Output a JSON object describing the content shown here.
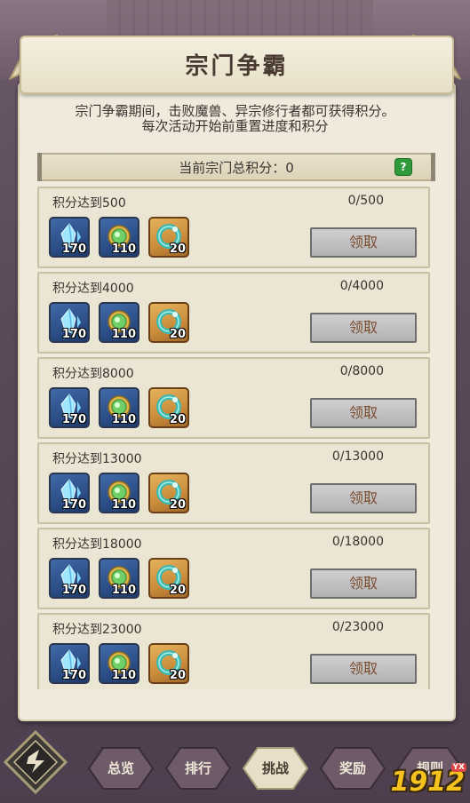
{
  "header": {
    "title": "宗门争霸"
  },
  "description": {
    "line1": "宗门争霸期间，击败魔兽、异宗修行者都可获得积分。",
    "line2": "每次活动开始前重置进度和积分"
  },
  "total": {
    "label": "当前宗门总积分：0",
    "help_icon": "help-icon"
  },
  "tasks": [
    {
      "title": "积分达到500",
      "progress": "0/500",
      "claim": "领取",
      "rewards": [
        {
          "icon": "crystal-icon",
          "count": "170"
        },
        {
          "icon": "green-gem-icon",
          "count": "110"
        },
        {
          "icon": "jade-ring-icon",
          "count": "20"
        }
      ]
    },
    {
      "title": "积分达到4000",
      "progress": "0/4000",
      "claim": "领取",
      "rewards": [
        {
          "icon": "crystal-icon",
          "count": "170"
        },
        {
          "icon": "green-gem-icon",
          "count": "110"
        },
        {
          "icon": "jade-ring-icon",
          "count": "20"
        }
      ]
    },
    {
      "title": "积分达到8000",
      "progress": "0/8000",
      "claim": "领取",
      "rewards": [
        {
          "icon": "crystal-icon",
          "count": "170"
        },
        {
          "icon": "green-gem-icon",
          "count": "110"
        },
        {
          "icon": "jade-ring-icon",
          "count": "20"
        }
      ]
    },
    {
      "title": "积分达到13000",
      "progress": "0/13000",
      "claim": "领取",
      "rewards": [
        {
          "icon": "crystal-icon",
          "count": "170"
        },
        {
          "icon": "green-gem-icon",
          "count": "110"
        },
        {
          "icon": "jade-ring-icon",
          "count": "20"
        }
      ]
    },
    {
      "title": "积分达到18000",
      "progress": "0/18000",
      "claim": "领取",
      "rewards": [
        {
          "icon": "crystal-icon",
          "count": "170"
        },
        {
          "icon": "green-gem-icon",
          "count": "110"
        },
        {
          "icon": "jade-ring-icon",
          "count": "20"
        }
      ]
    },
    {
      "title": "积分达到23000",
      "progress": "0/23000",
      "claim": "领取",
      "rewards": [
        {
          "icon": "crystal-icon",
          "count": "170"
        },
        {
          "icon": "green-gem-icon",
          "count": "110"
        },
        {
          "icon": "jade-ring-icon",
          "count": "20"
        }
      ]
    }
  ],
  "nav": {
    "home_icon": "sect-emblem-icon",
    "tabs": [
      {
        "label": "总览",
        "active": false
      },
      {
        "label": "排行",
        "active": false
      },
      {
        "label": "挑战",
        "active": true
      },
      {
        "label": "奖励",
        "active": false
      },
      {
        "label": "规则",
        "active": false
      }
    ]
  },
  "watermark": {
    "text": "1912",
    "badge": "YX"
  },
  "colors": {
    "panel": "#efeadc",
    "claim_text": "#7a4b30",
    "watermark": "#f6c21d",
    "help": "#2f9a3a"
  }
}
